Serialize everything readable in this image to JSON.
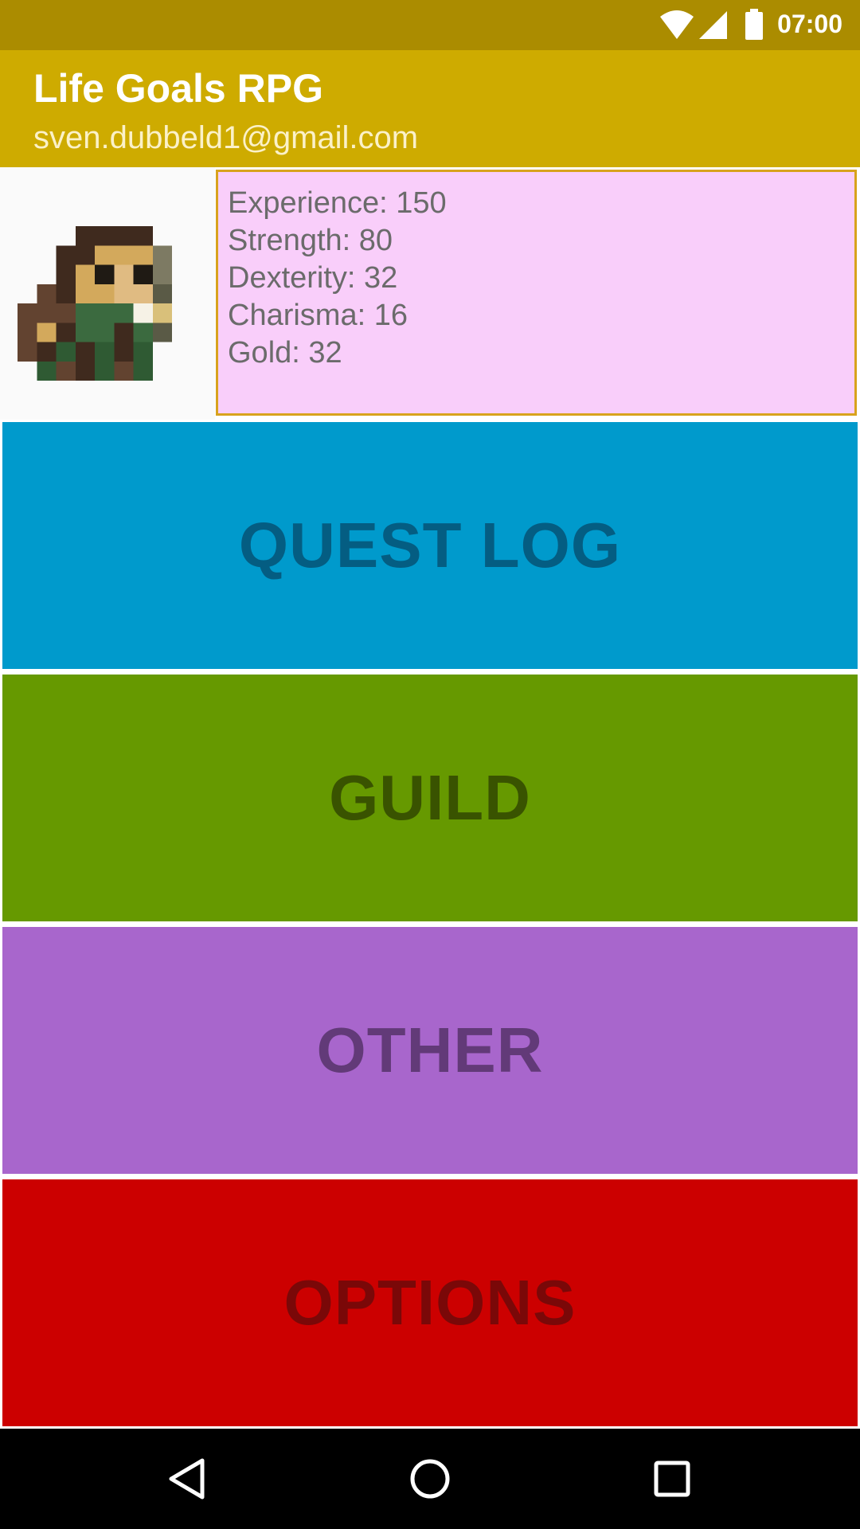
{
  "status_bar": {
    "time": "07:00",
    "icons": [
      "wifi-icon",
      "cell-signal-icon",
      "battery-icon"
    ],
    "color": "#ab8c00"
  },
  "app_bar": {
    "title": "Life Goals RPG",
    "subtitle": "sven.dubbeld1@gmail.com",
    "color": "#ceab00"
  },
  "profile": {
    "avatar_icon": "pixel-adventurer-avatar",
    "stats": [
      "Experience: 150",
      "Strength: 80",
      "Dexterity: 32",
      "Charisma: 16",
      "Gold: 32"
    ],
    "panel_color": "#f9cefa"
  },
  "menu": {
    "quest_log": {
      "label": "QUEST LOG",
      "color": "#009acc"
    },
    "guild": {
      "label": "GUILD",
      "color": "#669900"
    },
    "other": {
      "label": "OTHER",
      "color": "#a866cc"
    },
    "options": {
      "label": "OPTIONS",
      "color": "#cc0000"
    }
  },
  "nav_bar": {
    "icons": [
      "back-icon",
      "home-icon",
      "recents-icon"
    ]
  }
}
